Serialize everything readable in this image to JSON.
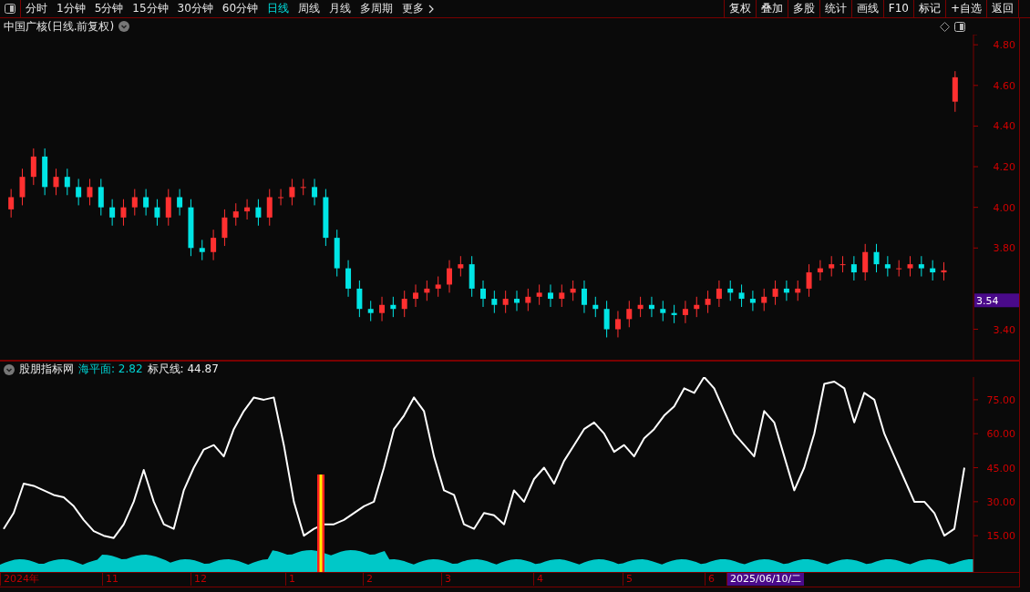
{
  "toolbar": {
    "periods": [
      {
        "label": "分时",
        "selected": false
      },
      {
        "label": "1分钟",
        "selected": false
      },
      {
        "label": "5分钟",
        "selected": false
      },
      {
        "label": "15分钟",
        "selected": false
      },
      {
        "label": "30分钟",
        "selected": false
      },
      {
        "label": "60分钟",
        "selected": false
      },
      {
        "label": "日线",
        "selected": true
      },
      {
        "label": "周线",
        "selected": false
      },
      {
        "label": "月线",
        "selected": false
      },
      {
        "label": "多周期",
        "selected": false
      }
    ],
    "more": "更多",
    "actions": [
      "复权",
      "叠加",
      "多股",
      "统计",
      "画线",
      "F10",
      "标记",
      "+自选",
      "返回"
    ]
  },
  "main_chart": {
    "title": "中国广核(日线.前复权)",
    "current_price": "3.54",
    "chart_data": {
      "type": "candlestick",
      "ylim": [
        3.25,
        4.85
      ],
      "yticks": [
        {
          "value": 4.8,
          "label": "4.80"
        },
        {
          "value": 4.6,
          "label": "4.60"
        },
        {
          "value": 4.4,
          "label": "4.40"
        },
        {
          "value": 4.2,
          "label": "4.20"
        },
        {
          "value": 4.0,
          "label": "4.00"
        },
        {
          "value": 3.8,
          "label": "3.80"
        },
        {
          "value": 3.4,
          "label": "3.40"
        }
      ],
      "categories": [
        null,
        null,
        null,
        null,
        null,
        null,
        null,
        null,
        null,
        null,
        null,
        null,
        null,
        null,
        null,
        null,
        null,
        null,
        null,
        null,
        null,
        null,
        null,
        null,
        null,
        null,
        null,
        null,
        null,
        null,
        null,
        null,
        null,
        null,
        null,
        null,
        null,
        null,
        null,
        null,
        null,
        null,
        null,
        null,
        null,
        null,
        null,
        null,
        null,
        null,
        null,
        null,
        null,
        null,
        null,
        null,
        null,
        null,
        null,
        null,
        null,
        null,
        null,
        null,
        null,
        null,
        null,
        null,
        null,
        null,
        null,
        null,
        null,
        null,
        null,
        null,
        null,
        null,
        null,
        null,
        null,
        null,
        null,
        null,
        null
      ],
      "ohlc": [
        [
          3.99,
          4.09,
          3.95,
          4.05
        ],
        [
          4.05,
          4.19,
          4.01,
          4.15
        ],
        [
          4.15,
          4.29,
          4.11,
          4.25
        ],
        [
          4.25,
          4.29,
          4.06,
          4.1
        ],
        [
          4.1,
          4.19,
          4.06,
          4.15
        ],
        [
          4.15,
          4.19,
          4.06,
          4.1
        ],
        [
          4.1,
          4.14,
          4.01,
          4.05
        ],
        [
          4.05,
          4.14,
          4.01,
          4.1
        ],
        [
          4.1,
          4.14,
          3.96,
          4.0
        ],
        [
          4.0,
          4.04,
          3.91,
          3.95
        ],
        [
          3.95,
          4.04,
          3.91,
          4.0
        ],
        [
          4.0,
          4.09,
          3.96,
          4.05
        ],
        [
          4.05,
          4.09,
          3.96,
          4.0
        ],
        [
          4.0,
          4.04,
          3.91,
          3.95
        ],
        [
          3.95,
          4.09,
          3.91,
          4.05
        ],
        [
          4.05,
          4.09,
          3.96,
          4.0
        ],
        [
          4.0,
          4.04,
          3.76,
          3.8
        ],
        [
          3.8,
          3.84,
          3.74,
          3.78
        ],
        [
          3.78,
          3.89,
          3.74,
          3.85
        ],
        [
          3.85,
          3.99,
          3.81,
          3.95
        ],
        [
          3.95,
          4.02,
          3.91,
          3.98
        ],
        [
          3.98,
          4.04,
          3.94,
          4.0
        ],
        [
          4.0,
          4.04,
          3.91,
          3.95
        ],
        [
          3.95,
          4.09,
          3.91,
          4.05
        ],
        [
          4.05,
          4.09,
          4.01,
          4.05
        ],
        [
          4.05,
          4.14,
          4.01,
          4.1
        ],
        [
          4.1,
          4.14,
          4.06,
          4.1
        ],
        [
          4.1,
          4.14,
          4.01,
          4.05
        ],
        [
          4.05,
          4.09,
          3.81,
          3.85
        ],
        [
          3.85,
          3.89,
          3.66,
          3.7
        ],
        [
          3.7,
          3.74,
          3.56,
          3.6
        ],
        [
          3.6,
          3.64,
          3.46,
          3.5
        ],
        [
          3.5,
          3.54,
          3.44,
          3.48
        ],
        [
          3.48,
          3.56,
          3.44,
          3.52
        ],
        [
          3.52,
          3.56,
          3.46,
          3.5
        ],
        [
          3.5,
          3.59,
          3.46,
          3.55
        ],
        [
          3.55,
          3.62,
          3.51,
          3.58
        ],
        [
          3.58,
          3.64,
          3.54,
          3.6
        ],
        [
          3.6,
          3.66,
          3.56,
          3.62
        ],
        [
          3.62,
          3.74,
          3.58,
          3.7
        ],
        [
          3.7,
          3.76,
          3.66,
          3.72
        ],
        [
          3.72,
          3.76,
          3.56,
          3.6
        ],
        [
          3.6,
          3.64,
          3.51,
          3.55
        ],
        [
          3.55,
          3.59,
          3.48,
          3.52
        ],
        [
          3.52,
          3.59,
          3.48,
          3.55
        ],
        [
          3.55,
          3.59,
          3.49,
          3.53
        ],
        [
          3.53,
          3.6,
          3.49,
          3.56
        ],
        [
          3.56,
          3.62,
          3.52,
          3.58
        ],
        [
          3.58,
          3.62,
          3.51,
          3.55
        ],
        [
          3.55,
          3.62,
          3.51,
          3.58
        ],
        [
          3.58,
          3.64,
          3.54,
          3.6
        ],
        [
          3.6,
          3.64,
          3.48,
          3.52
        ],
        [
          3.52,
          3.56,
          3.46,
          3.5
        ],
        [
          3.5,
          3.54,
          3.36,
          3.4
        ],
        [
          3.4,
          3.49,
          3.36,
          3.45
        ],
        [
          3.45,
          3.54,
          3.41,
          3.5
        ],
        [
          3.5,
          3.56,
          3.46,
          3.52
        ],
        [
          3.52,
          3.56,
          3.46,
          3.5
        ],
        [
          3.5,
          3.54,
          3.44,
          3.48
        ],
        [
          3.48,
          3.52,
          3.43,
          3.47
        ],
        [
          3.47,
          3.54,
          3.43,
          3.5
        ],
        [
          3.5,
          3.56,
          3.46,
          3.52
        ],
        [
          3.52,
          3.59,
          3.48,
          3.55
        ],
        [
          3.55,
          3.64,
          3.51,
          3.6
        ],
        [
          3.6,
          3.64,
          3.54,
          3.58
        ],
        [
          3.58,
          3.62,
          3.51,
          3.55
        ],
        [
          3.55,
          3.59,
          3.49,
          3.53
        ],
        [
          3.53,
          3.6,
          3.49,
          3.56
        ],
        [
          3.56,
          3.64,
          3.52,
          3.6
        ],
        [
          3.6,
          3.64,
          3.54,
          3.58
        ],
        [
          3.58,
          3.64,
          3.54,
          3.6
        ],
        [
          3.6,
          3.72,
          3.56,
          3.68
        ],
        [
          3.68,
          3.74,
          3.64,
          3.7
        ],
        [
          3.7,
          3.76,
          3.66,
          3.72
        ],
        [
          3.72,
          3.76,
          3.68,
          3.72
        ],
        [
          3.72,
          3.76,
          3.64,
          3.68
        ],
        [
          3.68,
          3.82,
          3.64,
          3.78
        ],
        [
          3.78,
          3.82,
          3.68,
          3.72
        ],
        [
          3.72,
          3.76,
          3.66,
          3.7
        ],
        [
          3.7,
          3.74,
          3.66,
          3.7
        ],
        [
          3.7,
          3.76,
          3.66,
          3.72
        ],
        [
          3.72,
          3.76,
          3.66,
          3.7
        ],
        [
          3.7,
          3.74,
          3.64,
          3.68
        ],
        [
          3.68,
          3.73,
          3.64,
          3.69
        ],
        [
          4.52,
          4.67,
          4.47,
          4.64
        ]
      ]
    }
  },
  "indicator": {
    "name": "股朋指标网",
    "sea_level": "海平面: 2.82",
    "ruler": "标尺线: 44.87",
    "chart_data": {
      "type": "line",
      "ylim": [
        -1,
        85
      ],
      "yticks": [
        {
          "value": 75,
          "label": "75.00"
        },
        {
          "value": 60,
          "label": "60.00"
        },
        {
          "value": 45,
          "label": "45.00"
        },
        {
          "value": 30,
          "label": "30.00"
        },
        {
          "value": 15,
          "label": "15.00"
        }
      ],
      "series": [
        {
          "color": "#ffffff",
          "values": [
            18,
            25,
            38,
            37,
            35,
            33,
            32,
            28,
            22,
            17,
            15,
            14,
            20,
            30,
            44,
            30,
            20,
            18,
            35,
            45,
            53,
            55,
            50,
            62,
            70,
            76,
            75,
            76,
            55,
            30,
            15,
            18,
            20,
            20,
            22,
            25,
            28,
            30,
            45,
            62,
            68,
            76,
            70,
            50,
            35,
            33,
            20,
            18,
            25,
            24,
            20,
            35,
            30,
            40,
            45,
            38,
            48,
            55,
            62,
            65,
            60,
            52,
            55,
            50,
            58,
            62,
            68,
            72,
            80,
            78,
            85,
            80,
            70,
            60,
            55,
            50,
            70,
            65,
            50,
            35,
            45,
            60,
            82,
            83,
            80,
            65,
            78,
            75,
            60,
            50,
            40,
            30,
            30,
            25,
            15,
            18,
            45
          ]
        }
      ]
    }
  },
  "time_axis": [
    {
      "label": "2024年",
      "selected": false
    },
    {
      "label": "11",
      "selected": false
    },
    {
      "label": "12",
      "selected": false
    },
    {
      "label": "1",
      "selected": false
    },
    {
      "label": "2",
      "selected": false
    },
    {
      "label": "3",
      "selected": false
    },
    {
      "label": "4",
      "selected": false
    },
    {
      "label": "5",
      "selected": false
    },
    {
      "label": "6",
      "selected": false
    },
    {
      "label": "2025/06/10/二",
      "selected": true
    }
  ]
}
